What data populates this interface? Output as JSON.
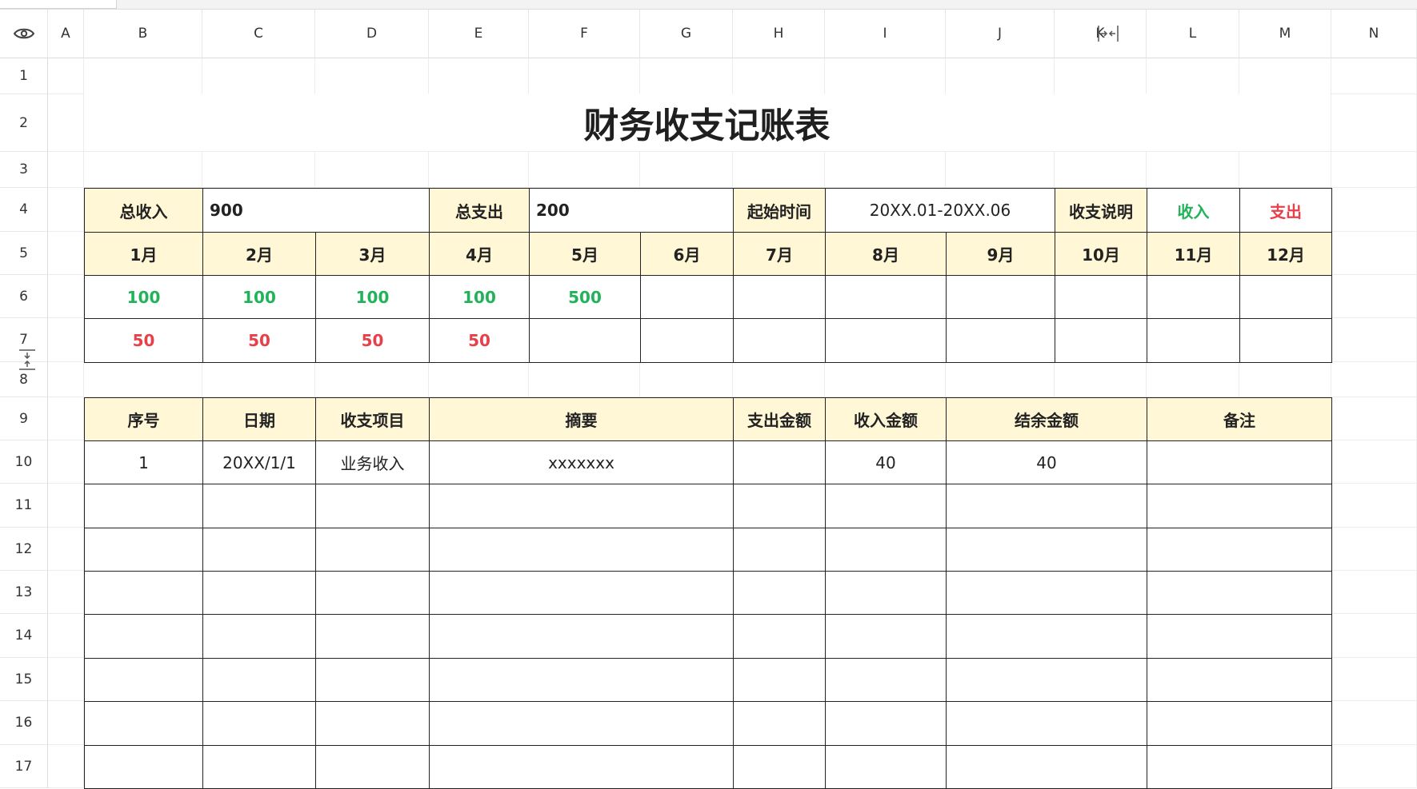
{
  "columns": [
    "A",
    "B",
    "C",
    "D",
    "E",
    "F",
    "G",
    "H",
    "I",
    "J",
    "K",
    "L",
    "M",
    "N"
  ],
  "rows": [
    "1",
    "2",
    "3",
    "4",
    "5",
    "6",
    "7",
    "8",
    "9",
    "10",
    "11",
    "12",
    "13",
    "14",
    "15",
    "16",
    "17"
  ],
  "title": "财务收支记账表",
  "summary": {
    "total_income_label": "总收入",
    "total_income_value": "900",
    "total_expense_label": "总支出",
    "total_expense_value": "200",
    "period_label": "起始时间",
    "period_value": "20XX.01-20XX.06",
    "legend_label": "收支说明",
    "legend_income": "收入",
    "legend_expense": "支出"
  },
  "months": [
    "1月",
    "2月",
    "3月",
    "4月",
    "5月",
    "6月",
    "7月",
    "8月",
    "9月",
    "10月",
    "11月",
    "12月"
  ],
  "monthly_income": [
    "100",
    "100",
    "100",
    "100",
    "500",
    "",
    "",
    "",
    "",
    "",
    "",
    ""
  ],
  "monthly_expense": [
    "50",
    "50",
    "50",
    "50",
    "",
    "",
    "",
    "",
    "",
    "",
    "",
    ""
  ],
  "ledger": {
    "headers": [
      "序号",
      "日期",
      "收支项目",
      "摘要",
      "支出金额",
      "收入金额",
      "结余金额",
      "备注"
    ],
    "rows": [
      [
        "1",
        "20XX/1/1",
        "业务收入",
        "xxxxxxx",
        "",
        "40",
        "40",
        ""
      ],
      [
        "",
        "",
        "",
        "",
        "",
        "",
        "",
        ""
      ],
      [
        "",
        "",
        "",
        "",
        "",
        "",
        "",
        ""
      ],
      [
        "",
        "",
        "",
        "",
        "",
        "",
        "",
        ""
      ],
      [
        "",
        "",
        "",
        "",
        "",
        "",
        "",
        ""
      ],
      [
        "",
        "",
        "",
        "",
        "",
        "",
        "",
        ""
      ],
      [
        "",
        "",
        "",
        "",
        "",
        "",
        "",
        ""
      ],
      [
        "",
        "",
        "",
        "",
        "",
        "",
        "",
        ""
      ]
    ]
  },
  "colors": {
    "income": "#22b35a",
    "expense": "#e8404a",
    "header_fill": "#fff7d6"
  },
  "icons": {
    "corner": "eye-icon",
    "column_resize": "column-resize-icon",
    "row_resize": "row-resize-icon"
  }
}
